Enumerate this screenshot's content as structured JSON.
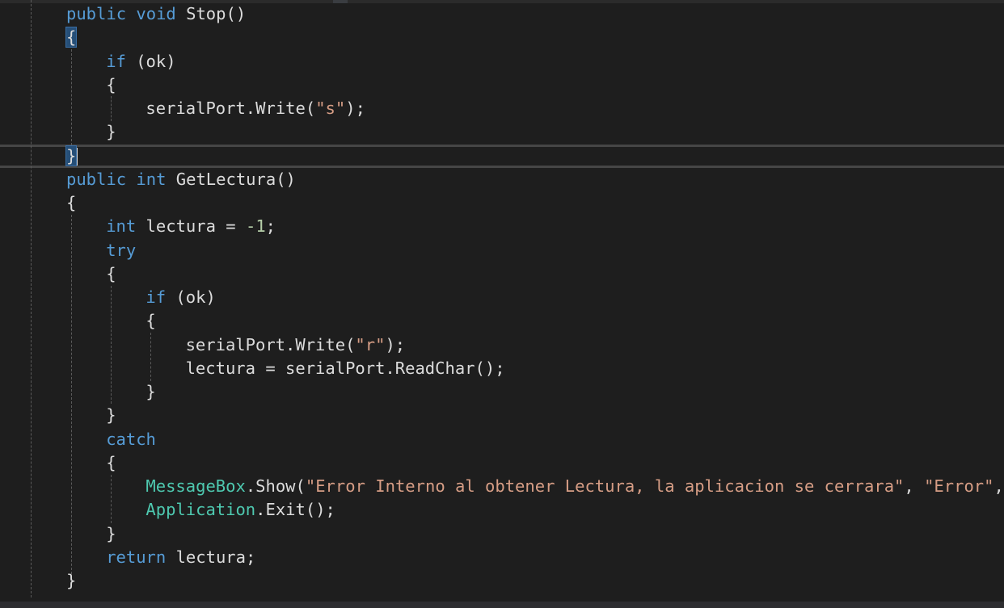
{
  "editor": {
    "language": "csharp",
    "colors": {
      "background": "#1e1e1e",
      "keyword": "#569cd6",
      "type": "#4ec9b0",
      "string": "#d69d85",
      "number": "#b5cea8",
      "plain": "#dcdcdc",
      "brace_highlight": "#264f78"
    },
    "lines": [
      {
        "indent": 0,
        "tokens": [
          {
            "t": "public",
            "c": "kw"
          },
          {
            "t": " ",
            "c": "pl"
          },
          {
            "t": "void",
            "c": "kw"
          },
          {
            "t": " Stop()",
            "c": "pl"
          }
        ]
      },
      {
        "indent": 0,
        "tokens": [
          {
            "t": "{",
            "c": "pl",
            "hl": true
          }
        ]
      },
      {
        "indent": 1,
        "tokens": [
          {
            "t": "if",
            "c": "kw"
          },
          {
            "t": " (ok)",
            "c": "pl"
          }
        ]
      },
      {
        "indent": 1,
        "tokens": [
          {
            "t": "{",
            "c": "pl"
          }
        ]
      },
      {
        "indent": 2,
        "tokens": [
          {
            "t": "serialPort.Write(",
            "c": "pl"
          },
          {
            "t": "\"s\"",
            "c": "str"
          },
          {
            "t": ");",
            "c": "pl"
          }
        ]
      },
      {
        "indent": 1,
        "tokens": [
          {
            "t": "}",
            "c": "pl"
          }
        ]
      },
      {
        "indent": 0,
        "tokens": [
          {
            "t": "}",
            "c": "pl",
            "hl": true,
            "caret": true
          }
        ]
      },
      {
        "indent": 0,
        "tokens": [
          {
            "t": "public",
            "c": "kw"
          },
          {
            "t": " ",
            "c": "pl"
          },
          {
            "t": "int",
            "c": "kw"
          },
          {
            "t": " GetLectura()",
            "c": "pl"
          }
        ]
      },
      {
        "indent": 0,
        "tokens": [
          {
            "t": "{",
            "c": "pl"
          }
        ]
      },
      {
        "indent": 1,
        "tokens": [
          {
            "t": "int",
            "c": "kw"
          },
          {
            "t": " lectura = ",
            "c": "pl"
          },
          {
            "t": "-1",
            "c": "num"
          },
          {
            "t": ";",
            "c": "pl"
          }
        ]
      },
      {
        "indent": 1,
        "tokens": [
          {
            "t": "try",
            "c": "kw"
          }
        ]
      },
      {
        "indent": 1,
        "tokens": [
          {
            "t": "{",
            "c": "pl"
          }
        ]
      },
      {
        "indent": 2,
        "tokens": [
          {
            "t": "if",
            "c": "kw"
          },
          {
            "t": " (ok)",
            "c": "pl"
          }
        ]
      },
      {
        "indent": 2,
        "tokens": [
          {
            "t": "{",
            "c": "pl"
          }
        ]
      },
      {
        "indent": 3,
        "tokens": [
          {
            "t": "serialPort.Write(",
            "c": "pl"
          },
          {
            "t": "\"r\"",
            "c": "str"
          },
          {
            "t": ");",
            "c": "pl"
          }
        ]
      },
      {
        "indent": 3,
        "tokens": [
          {
            "t": "lectura = serialPort.ReadChar();",
            "c": "pl"
          }
        ]
      },
      {
        "indent": 2,
        "tokens": [
          {
            "t": "}",
            "c": "pl"
          }
        ]
      },
      {
        "indent": 1,
        "tokens": [
          {
            "t": "}",
            "c": "pl"
          }
        ]
      },
      {
        "indent": 1,
        "tokens": [
          {
            "t": "catch",
            "c": "kw"
          }
        ]
      },
      {
        "indent": 1,
        "tokens": [
          {
            "t": "{",
            "c": "pl"
          }
        ]
      },
      {
        "indent": 2,
        "tokens": [
          {
            "t": "MessageBox",
            "c": "tp"
          },
          {
            "t": ".Show(",
            "c": "pl"
          },
          {
            "t": "\"Error Interno al obtener Lectura, la aplicacion se cerrara\"",
            "c": "str"
          },
          {
            "t": ", ",
            "c": "pl"
          },
          {
            "t": "\"Error\"",
            "c": "str"
          },
          {
            "t": ",",
            "c": "pl"
          }
        ]
      },
      {
        "indent": 2,
        "tokens": [
          {
            "t": "Application",
            "c": "tp"
          },
          {
            "t": ".Exit();",
            "c": "pl"
          }
        ]
      },
      {
        "indent": 1,
        "tokens": [
          {
            "t": "}",
            "c": "pl"
          }
        ]
      },
      {
        "indent": 1,
        "tokens": [
          {
            "t": "return",
            "c": "kw"
          },
          {
            "t": " lectura;",
            "c": "pl"
          }
        ]
      },
      {
        "indent": 0,
        "tokens": [
          {
            "t": "}",
            "c": "pl"
          }
        ]
      }
    ]
  }
}
